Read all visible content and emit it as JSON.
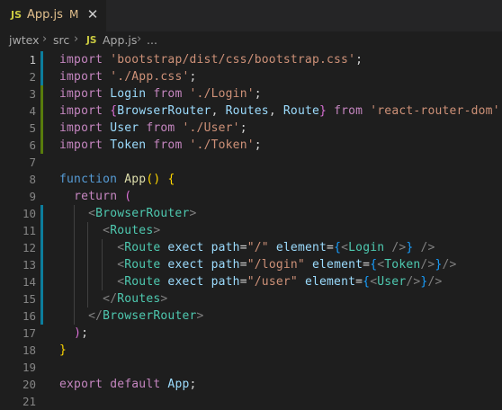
{
  "tab": {
    "icon": "JS",
    "filename": "App.js",
    "status": "M",
    "close_glyph": "✕"
  },
  "breadcrumb": {
    "parts": [
      "jwtex",
      "src",
      "JS",
      "App.js",
      "..."
    ]
  },
  "colors": {
    "editor_bg": "#1e1e1e",
    "git_added": "#587c0c",
    "git_modified": "#0c7d9d",
    "keyword": "#c586c0",
    "string": "#ce9178",
    "jsx_tag": "#4ec9b0"
  },
  "lines": [
    {
      "n": "1",
      "git": "modified",
      "tokens": [
        [
          "import",
          "kw"
        ],
        [
          " "
        ],
        [
          "'bootstrap/dist/css/bootstrap.css'",
          "str"
        ],
        [
          ";",
          "plain"
        ]
      ]
    },
    {
      "n": "2",
      "git": "modified",
      "tokens": [
        [
          "import",
          "kw"
        ],
        [
          " "
        ],
        [
          "'./App.css'",
          "str"
        ],
        [
          ";",
          "plain"
        ]
      ]
    },
    {
      "n": "3",
      "git": "added",
      "tokens": [
        [
          "import",
          "kw"
        ],
        [
          " "
        ],
        [
          "Login",
          "var"
        ],
        [
          " "
        ],
        [
          "from",
          "kw"
        ],
        [
          " "
        ],
        [
          "'./Login'",
          "str"
        ],
        [
          ";",
          "plain"
        ]
      ]
    },
    {
      "n": "4",
      "git": "added",
      "tokens": [
        [
          "import",
          "kw"
        ],
        [
          " "
        ],
        [
          "{",
          "br2"
        ],
        [
          "BrowserRouter",
          "var"
        ],
        [
          ", ",
          "plain"
        ],
        [
          "Routes",
          "var"
        ],
        [
          ", ",
          "plain"
        ],
        [
          "Route",
          "var"
        ],
        [
          "}",
          "br2"
        ],
        [
          " "
        ],
        [
          "from",
          "kw"
        ],
        [
          " "
        ],
        [
          "'react-router-dom'",
          "str"
        ],
        [
          ";",
          "plain"
        ]
      ]
    },
    {
      "n": "5",
      "git": "added",
      "tokens": [
        [
          "import",
          "kw"
        ],
        [
          " "
        ],
        [
          "User",
          "var"
        ],
        [
          " "
        ],
        [
          "from",
          "kw"
        ],
        [
          " "
        ],
        [
          "'./User'",
          "str"
        ],
        [
          ";",
          "plain"
        ]
      ]
    },
    {
      "n": "6",
      "git": "added",
      "tokens": [
        [
          "import",
          "kw"
        ],
        [
          " "
        ],
        [
          "Token",
          "var"
        ],
        [
          " "
        ],
        [
          "from",
          "kw"
        ],
        [
          " "
        ],
        [
          "'./Token'",
          "str"
        ],
        [
          ";",
          "plain"
        ]
      ]
    },
    {
      "n": "7",
      "git": "",
      "tokens": []
    },
    {
      "n": "8",
      "git": "",
      "tokens": [
        [
          "function",
          "dkw"
        ],
        [
          " "
        ],
        [
          "App",
          "fn"
        ],
        [
          "()",
          "br1"
        ],
        [
          " "
        ],
        [
          "{",
          "br1"
        ]
      ]
    },
    {
      "n": "9",
      "git": "",
      "tokens": [
        [
          "  "
        ],
        [
          "return",
          "kw"
        ],
        [
          " "
        ],
        [
          "(",
          "br2"
        ]
      ]
    },
    {
      "n": "10",
      "git": "modified",
      "tokens": [
        [
          "    "
        ],
        [
          "<",
          "punc"
        ],
        [
          "BrowserRouter",
          "tag"
        ],
        [
          ">",
          "punc"
        ]
      ]
    },
    {
      "n": "11",
      "git": "modified",
      "tokens": [
        [
          "      "
        ],
        [
          "<",
          "punc"
        ],
        [
          "Routes",
          "tag"
        ],
        [
          ">",
          "punc"
        ]
      ]
    },
    {
      "n": "12",
      "git": "modified",
      "tokens": [
        [
          "        "
        ],
        [
          "<",
          "punc"
        ],
        [
          "Route",
          "tag"
        ],
        [
          " "
        ],
        [
          "exect",
          "attr"
        ],
        [
          " "
        ],
        [
          "path",
          "attr"
        ],
        [
          "=",
          "plain"
        ],
        [
          "\"/\"",
          "str"
        ],
        [
          " "
        ],
        [
          "element",
          "attr"
        ],
        [
          "=",
          "plain"
        ],
        [
          "{",
          "br3"
        ],
        [
          "<",
          "punc"
        ],
        [
          "Login",
          "tag"
        ],
        [
          " ",
          "plain"
        ],
        [
          "/>",
          "punc"
        ],
        [
          "}",
          "br3"
        ],
        [
          " "
        ],
        [
          "/>",
          "punc"
        ]
      ]
    },
    {
      "n": "13",
      "git": "modified",
      "tokens": [
        [
          "        "
        ],
        [
          "<",
          "punc"
        ],
        [
          "Route",
          "tag"
        ],
        [
          " "
        ],
        [
          "exect",
          "attr"
        ],
        [
          " "
        ],
        [
          "path",
          "attr"
        ],
        [
          "=",
          "plain"
        ],
        [
          "\"/login\"",
          "str"
        ],
        [
          " "
        ],
        [
          "element",
          "attr"
        ],
        [
          "=",
          "plain"
        ],
        [
          "{",
          "br3"
        ],
        [
          "<",
          "punc"
        ],
        [
          "Token",
          "tag"
        ],
        [
          "/>",
          "punc"
        ],
        [
          "}",
          "br3"
        ],
        [
          "/>",
          "punc"
        ]
      ]
    },
    {
      "n": "14",
      "git": "modified",
      "tokens": [
        [
          "        "
        ],
        [
          "<",
          "punc"
        ],
        [
          "Route",
          "tag"
        ],
        [
          " "
        ],
        [
          "exect",
          "attr"
        ],
        [
          " "
        ],
        [
          "path",
          "attr"
        ],
        [
          "=",
          "plain"
        ],
        [
          "\"/user\"",
          "str"
        ],
        [
          " "
        ],
        [
          "element",
          "attr"
        ],
        [
          "=",
          "plain"
        ],
        [
          "{",
          "br3"
        ],
        [
          "<",
          "punc"
        ],
        [
          "User",
          "tag"
        ],
        [
          "/>",
          "punc"
        ],
        [
          "}",
          "br3"
        ],
        [
          "/>",
          "punc"
        ]
      ]
    },
    {
      "n": "15",
      "git": "modified",
      "tokens": [
        [
          "      "
        ],
        [
          "</",
          "punc"
        ],
        [
          "Routes",
          "tag"
        ],
        [
          ">",
          "punc"
        ]
      ]
    },
    {
      "n": "16",
      "git": "modified",
      "tokens": [
        [
          "    "
        ],
        [
          "</",
          "punc"
        ],
        [
          "BrowserRouter",
          "tag"
        ],
        [
          ">",
          "punc"
        ]
      ]
    },
    {
      "n": "17",
      "git": "",
      "tokens": [
        [
          "  "
        ],
        [
          ")",
          "br2"
        ],
        [
          ";",
          "plain"
        ]
      ]
    },
    {
      "n": "18",
      "git": "",
      "tokens": [
        [
          "}",
          "br1"
        ]
      ]
    },
    {
      "n": "19",
      "git": "",
      "tokens": []
    },
    {
      "n": "20",
      "git": "",
      "tokens": [
        [
          "export",
          "kw"
        ],
        [
          " "
        ],
        [
          "default",
          "kw"
        ],
        [
          " "
        ],
        [
          "App",
          "var"
        ],
        [
          ";",
          "plain"
        ]
      ]
    },
    {
      "n": "21",
      "git": "",
      "tokens": []
    }
  ]
}
